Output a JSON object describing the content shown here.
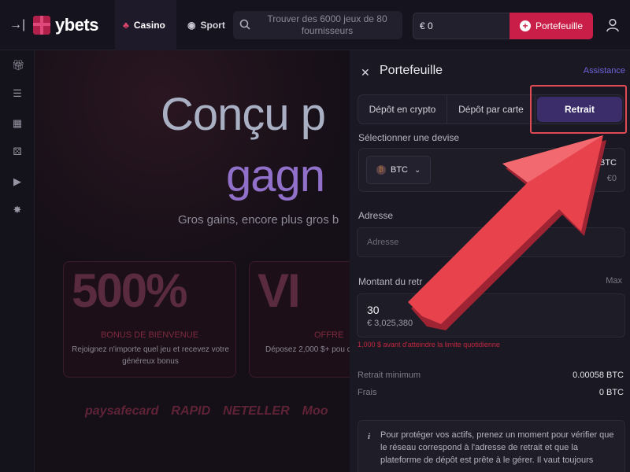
{
  "header": {
    "brand": "ybets",
    "tabs": [
      {
        "label": "Casino",
        "active": true
      },
      {
        "label": "Sport",
        "active": false
      }
    ],
    "search_placeholder": "Trouver des 6000 jeux de 80 fournisseurs",
    "balance": "€ 0",
    "wallet_button": "Portefeuille"
  },
  "sidebar": {
    "icons": [
      "gift-icon",
      "search-list-icon",
      "grid-icon",
      "dice-icon",
      "play-icon",
      "sparkle-icon"
    ]
  },
  "main": {
    "hero_line1": "Conçu p",
    "hero_line2": "gagn",
    "hero_subtitle": "Gros gains, encore plus gros b",
    "promos": [
      {
        "big": "500%",
        "title": "BONUS DE BIENVENUE",
        "desc": "Rejoignez n'importe quel jeu et recevez votre généreux bonus"
      },
      {
        "big": "VI",
        "title": "OFFRE",
        "desc": "Déposez 2,000 $+ pou débloquer des avan"
      }
    ],
    "payment_logos": [
      "paysafecard",
      "RAPID",
      "NETELLER",
      "Moo"
    ],
    "footer_partial": "C  ...  "
  },
  "wallet": {
    "title": "Portefeuille",
    "assistance": "Assistance",
    "tabs": [
      "Dépôt en crypto",
      "Dépôt par carte",
      "Retrait"
    ],
    "active_tab": "Retrait",
    "currency_label": "Sélectionner une devise",
    "currency": "BTC",
    "currency_amount": "0 BTC",
    "currency_eur": "€0",
    "address_label": "Adresse",
    "address_placeholder": "Adresse",
    "amount_label": "Montant du retr",
    "max_label": "Max",
    "amount_value": "30",
    "amount_eur": "€ 3,025,380",
    "limit_note": "1,000 $ avant d'atteindre la limite quotidienne",
    "min_label": "Retrait minimum",
    "min_value": "0.00058 BTC",
    "fee_label": "Frais",
    "fee_value": "0 BTC",
    "info_text": "Pour protéger vos actifs, prenez un moment pour vérifier que le réseau correspond à l'adresse de retrait et que la plateforme de dépôt est prête à le gérer. Il vaut toujours"
  },
  "colors": {
    "accent": "#c81e48",
    "active_tab": "#3a2d6a",
    "highlight": "#e04a55",
    "arrow": "#e8434d"
  }
}
